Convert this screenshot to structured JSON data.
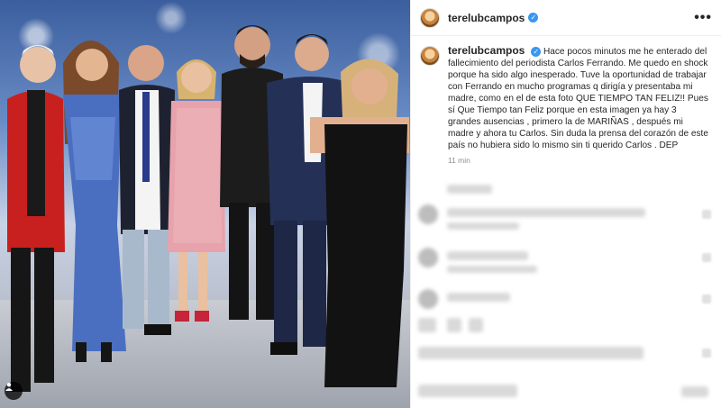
{
  "post": {
    "username": "terelubcampos",
    "verified": true,
    "more_label": "•••"
  },
  "caption": {
    "username": "terelubcampos",
    "text": "Hace pocos minutos me he enterado del fallecimiento del periodista Carlos Ferrando. Me quedo en shock porque ha sido algo inesperado. Tuve la oportunidad de trabajar con Ferrando en mucho programas q dirigía y presentaba mi madre, como en el de esta foto QUE TIEMPO TAN FELIZ!! Pues sí Que Tiempo tan Feliz porque en esta imagen ya hay 3 grandes ausencias , primero la de MARIÑAS , después mi madre y ahora tu Carlos. Sin duda la prensa del corazón de este país no hubiera sido lo mismo sin ti querido Carlos . DEP",
    "time": "11 min"
  },
  "icons": {
    "verified": "verified-badge-icon",
    "more": "more-options-icon",
    "tag": "user-tag-icon"
  },
  "colors": {
    "verified": "#3897f0",
    "muted": "#8e8e8e"
  }
}
